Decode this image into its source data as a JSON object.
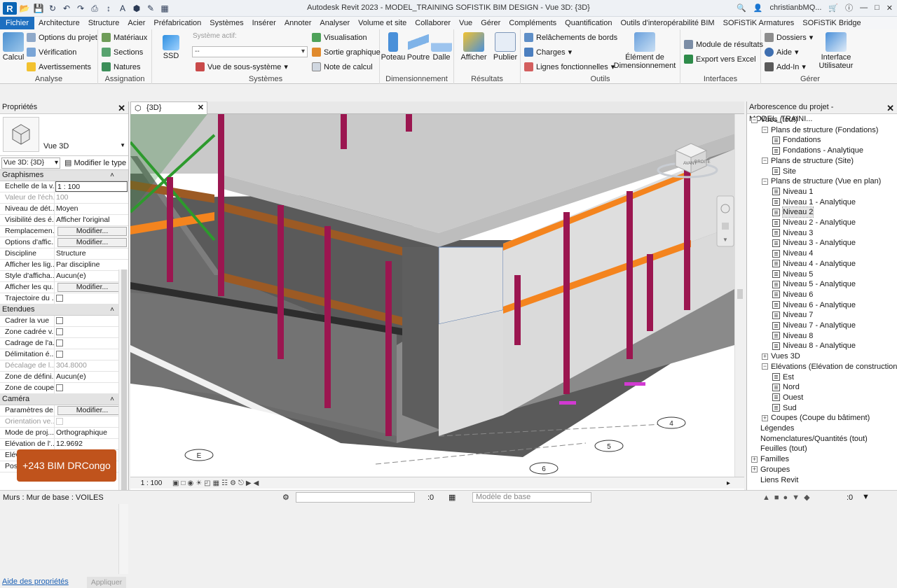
{
  "app": {
    "title": "Autodesk Revit 2023 - MODEL_TRAINING SOFISTIK BIM DESIGN - Vue 3D: {3D}",
    "user": "christianbMQ...",
    "logo": "R"
  },
  "tabs": [
    "Fichier",
    "Architecture",
    "Structure",
    "Acier",
    "Préfabrication",
    "Systèmes",
    "Insérer",
    "Annoter",
    "Analyser",
    "Volume et site",
    "Collaborer",
    "Vue",
    "Gérer",
    "Compléments",
    "Quantification",
    "Outils d'interopérabilité BIM",
    "SOFiSTiK Armatures",
    "SOFiSTiK Bridge"
  ],
  "ribbon": {
    "analyse": {
      "label": "Analyse",
      "calcul": "Calcul",
      "options": "Options du projet",
      "verification": "Vérification",
      "avert": "Avertissements"
    },
    "assignation": {
      "label": "Assignation",
      "materiaux": "Matériaux",
      "sections": "Sections",
      "natures": "Natures"
    },
    "systemes": {
      "label": "Systèmes",
      "ssd": "SSD",
      "actif_label": "Système actif:",
      "actif_value": "--",
      "sous": "Vue de sous-système",
      "visu": "Visualisation",
      "sortie": "Sortie graphique",
      "note": "Note de calcul"
    },
    "dimensionnement": {
      "label": "Dimensionnement",
      "poteau": "Poteau",
      "poutre": "Poutre",
      "dalle": "Dalle"
    },
    "resultats": {
      "label": "Résultats",
      "afficher": "Afficher",
      "publier": "Publier"
    },
    "outils": {
      "label": "Outils",
      "relach": "Relâchements de bords",
      "charges": "Charges",
      "lignes": "Lignes fonctionnelles",
      "element": "Élément de Dimensionnement"
    },
    "interfaces": {
      "label": "Interfaces",
      "module": "Module de résultats",
      "export": "Export vers Excel"
    },
    "gerer": {
      "label": "Gérer",
      "dossiers": "Dossiers",
      "aide": "Aide",
      "addin": "Add-In",
      "interface": "Interface Utilisateur"
    }
  },
  "properties": {
    "title": "Propriétés",
    "type_name": "Vue 3D",
    "instance": "Vue 3D: {3D}",
    "modify_type": "Modifier le type",
    "groups": [
      {
        "name": "Graphismes",
        "rows": [
          {
            "k": "Echelle de la v...",
            "v": "1 : 100",
            "kind": "input"
          },
          {
            "k": "Valeur de l'éch...",
            "v": "100",
            "kind": "dis"
          },
          {
            "k": "Niveau de dét...",
            "v": "Moyen"
          },
          {
            "k": "Visibilité des é...",
            "v": "Afficher l'original"
          },
          {
            "k": "Remplacemen...",
            "v": "Modifier...",
            "kind": "btn"
          },
          {
            "k": "Options d'affic...",
            "v": "Modifier...",
            "kind": "btn"
          },
          {
            "k": "Discipline",
            "v": "Structure"
          },
          {
            "k": "Afficher les lig...",
            "v": "Par discipline"
          },
          {
            "k": "Style d'afficha...",
            "v": "Aucun(e)"
          },
          {
            "k": "Afficher les qu...",
            "v": "Modifier...",
            "kind": "btn"
          },
          {
            "k": "Trajectoire du ...",
            "v": "",
            "kind": "cb"
          }
        ]
      },
      {
        "name": "Etendues",
        "rows": [
          {
            "k": "Cadrer la vue",
            "v": "",
            "kind": "cb"
          },
          {
            "k": "Zone cadrée v...",
            "v": "",
            "kind": "cb"
          },
          {
            "k": "Cadrage de l'a...",
            "v": "",
            "kind": "cb"
          },
          {
            "k": "Délimitation é...",
            "v": "",
            "kind": "cb"
          },
          {
            "k": "Décalage de l...",
            "v": "304.8000",
            "kind": "dis"
          },
          {
            "k": "Zone de défini...",
            "v": "Aucun(e)"
          },
          {
            "k": "Zone de coupe",
            "v": "",
            "kind": "cb"
          }
        ]
      },
      {
        "name": "Caméra",
        "rows": [
          {
            "k": "Paramètres de...",
            "v": "Modifier...",
            "kind": "btn"
          },
          {
            "k": "Orientation ve...",
            "v": "",
            "kind": "discb"
          },
          {
            "k": "Mode de proj...",
            "v": "Orthographique"
          },
          {
            "k": "Elévation de l'...",
            "v": "12.9692"
          },
          {
            "k": "Elév...",
            "v": ""
          },
          {
            "k": "Posi...",
            "v": ""
          }
        ]
      }
    ],
    "help": "Aide des propriétés",
    "apply": "Appliquer"
  },
  "badge": "+243 BIM DRCongo",
  "view": {
    "tab": "{3D}",
    "scale": "1 : 100",
    "cube_front": "AVANT",
    "cube_right": "DROITE",
    "grids": [
      "E",
      "5",
      "6",
      "4"
    ]
  },
  "tree": {
    "title": "Arborescence du projet - MODEL_TRAINI...",
    "items": [
      {
        "t": "Vues (tout)",
        "lvl": 0,
        "exp": "-"
      },
      {
        "t": "Plans de structure (Fondations)",
        "lvl": 1,
        "exp": "-"
      },
      {
        "t": "Fondations",
        "lvl": 2,
        "view": true
      },
      {
        "t": "Fondations - Analytique",
        "lvl": 2,
        "view": true
      },
      {
        "t": "Plans de structure (Site)",
        "lvl": 1,
        "exp": "-"
      },
      {
        "t": "Site",
        "lvl": 2,
        "view": true
      },
      {
        "t": "Plans de structure (Vue en plan)",
        "lvl": 1,
        "exp": "-"
      },
      {
        "t": "Niveau 1",
        "lvl": 2,
        "view": true
      },
      {
        "t": "Niveau 1 - Analytique",
        "lvl": 2,
        "view": true
      },
      {
        "t": "Niveau 2",
        "lvl": 2,
        "view": true,
        "sel": true
      },
      {
        "t": "Niveau 2 - Analytique",
        "lvl": 2,
        "view": true
      },
      {
        "t": "Niveau 3",
        "lvl": 2,
        "view": true
      },
      {
        "t": "Niveau 3 - Analytique",
        "lvl": 2,
        "view": true
      },
      {
        "t": "Niveau 4",
        "lvl": 2,
        "view": true
      },
      {
        "t": "Niveau 4 - Analytique",
        "lvl": 2,
        "view": true
      },
      {
        "t": "Niveau 5",
        "lvl": 2,
        "view": true
      },
      {
        "t": "Niveau 5 - Analytique",
        "lvl": 2,
        "view": true
      },
      {
        "t": "Niveau 6",
        "lvl": 2,
        "view": true
      },
      {
        "t": "Niveau 6 - Analytique",
        "lvl": 2,
        "view": true
      },
      {
        "t": "Niveau 7",
        "lvl": 2,
        "view": true
      },
      {
        "t": "Niveau 7 - Analytique",
        "lvl": 2,
        "view": true
      },
      {
        "t": "Niveau 8",
        "lvl": 2,
        "view": true
      },
      {
        "t": "Niveau 8 - Analytique",
        "lvl": 2,
        "view": true
      },
      {
        "t": "Vues 3D",
        "lvl": 1,
        "exp": "+"
      },
      {
        "t": "Elévations (Elévation de construction)",
        "lvl": 1,
        "exp": "-"
      },
      {
        "t": "Est",
        "lvl": 2,
        "view": true
      },
      {
        "t": "Nord",
        "lvl": 2,
        "view": true
      },
      {
        "t": "Ouest",
        "lvl": 2,
        "view": true
      },
      {
        "t": "Sud",
        "lvl": 2,
        "view": true
      },
      {
        "t": "Coupes (Coupe du bâtiment)",
        "lvl": 1,
        "exp": "+"
      },
      {
        "t": "Légendes",
        "lvl": 0
      },
      {
        "t": "Nomenclatures/Quantités (tout)",
        "lvl": 0
      },
      {
        "t": "Feuilles (tout)",
        "lvl": 0
      },
      {
        "t": "Familles",
        "lvl": 0,
        "exp": "+"
      },
      {
        "t": "Groupes",
        "lvl": 0,
        "exp": "+"
      },
      {
        "t": "Liens Revit",
        "lvl": 0
      }
    ]
  },
  "status": {
    "text": "Murs : Mur de base : VOILES",
    "zero1": ":0",
    "model": "Modèle de base",
    "zero2": ":0"
  }
}
